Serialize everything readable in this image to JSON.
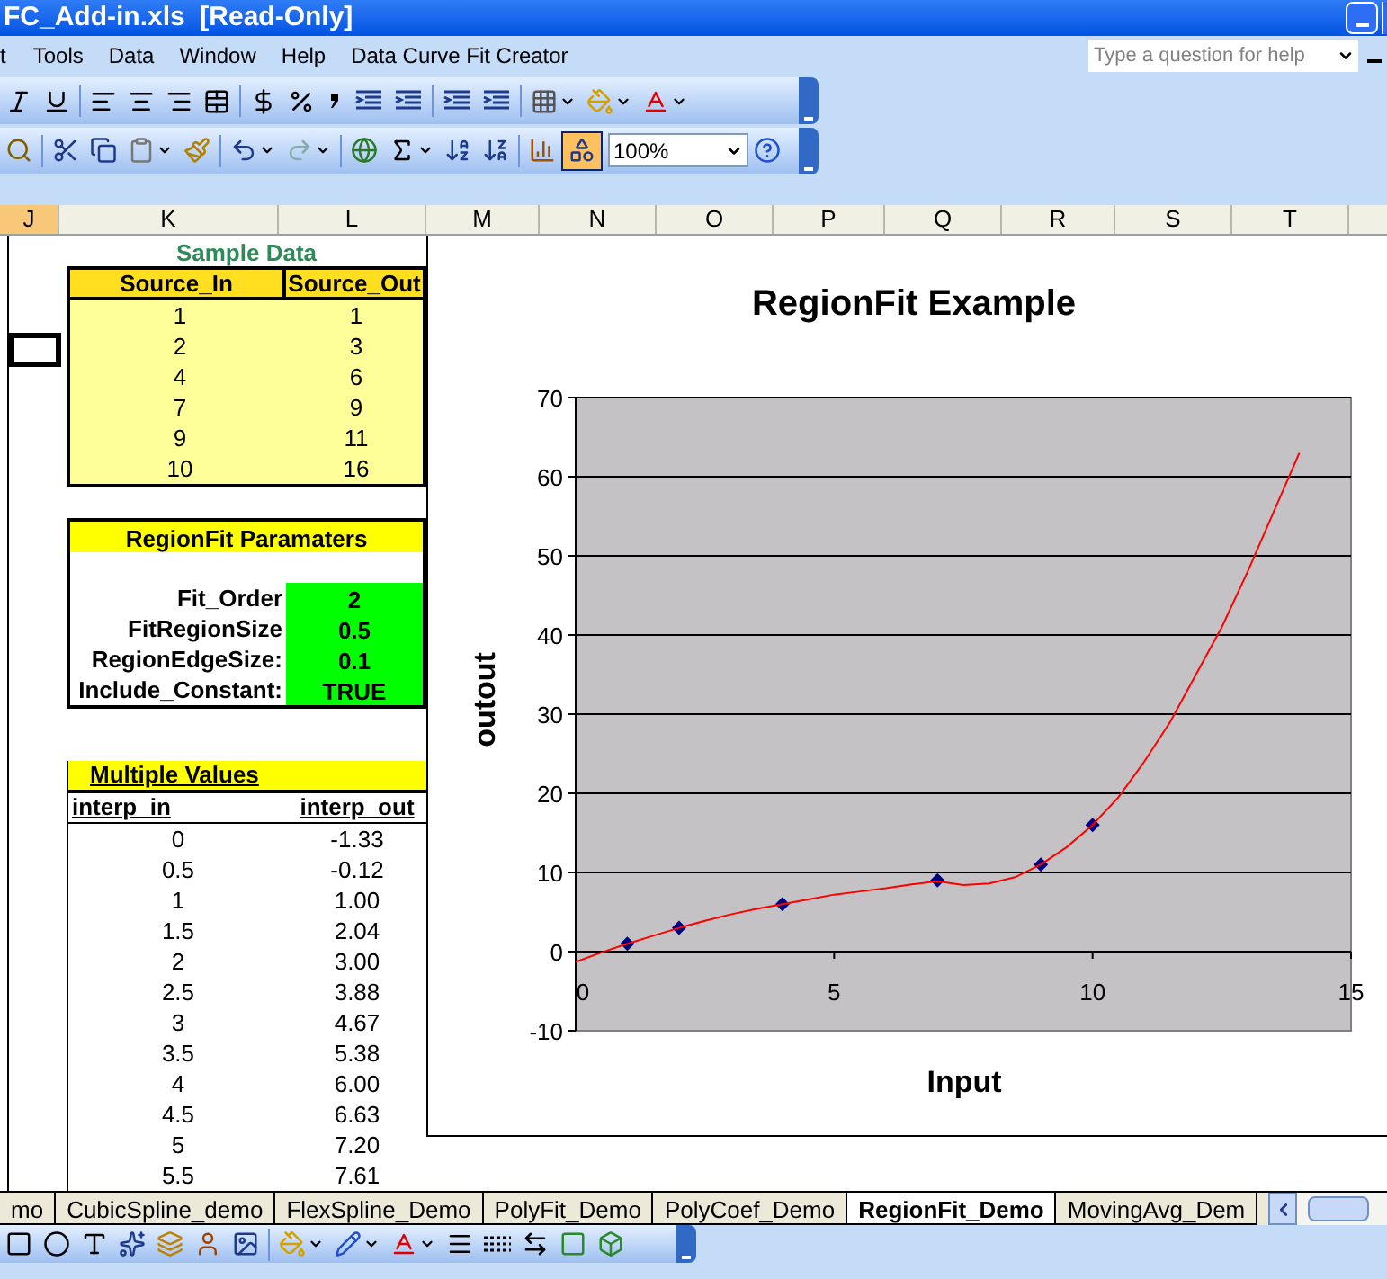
{
  "window": {
    "title": "FC_Add-in.xls  [Read-Only]"
  },
  "menu": [
    {
      "label": "t"
    },
    {
      "label": "Tools"
    },
    {
      "label": "Data"
    },
    {
      "label": "Window"
    },
    {
      "label": "Help"
    },
    {
      "label": "Data Curve Fit Creator"
    }
  ],
  "help_box": {
    "placeholder": "Type a question for help"
  },
  "toolbar": {
    "zoom": "100%",
    "drawing_pressed": true
  },
  "columns": [
    {
      "label": "J",
      "selected": true
    },
    {
      "label": "K",
      "selected": false
    },
    {
      "label": "L",
      "selected": false
    },
    {
      "label": "M",
      "selected": false
    },
    {
      "label": "N",
      "selected": false
    },
    {
      "label": "O",
      "selected": false
    },
    {
      "label": "P",
      "selected": false
    },
    {
      "label": "Q",
      "selected": false
    },
    {
      "label": "R",
      "selected": false
    },
    {
      "label": "S",
      "selected": false
    },
    {
      "label": "T",
      "selected": false
    }
  ],
  "sample_data": {
    "title": "Sample Data",
    "columns": [
      "Source_In",
      "Source_Out"
    ],
    "rows": [
      [
        "1",
        "1"
      ],
      [
        "2",
        "3"
      ],
      [
        "4",
        "6"
      ],
      [
        "7",
        "9"
      ],
      [
        "9",
        "11"
      ],
      [
        "10",
        "16"
      ]
    ]
  },
  "parameters": {
    "title": "RegionFit Paramaters",
    "rows": [
      {
        "label": "Fit_Order",
        "value": "2"
      },
      {
        "label": "FitRegionSize",
        "value": "0.5"
      },
      {
        "label": "RegionEdgeSize:",
        "value": "0.1"
      },
      {
        "label": "Include_Constant:",
        "value": "TRUE"
      }
    ]
  },
  "multiple_values": {
    "title": "Multiple Values",
    "columns": [
      "interp_in",
      "interp_out"
    ],
    "rows": [
      [
        "0",
        "-1.33"
      ],
      [
        "0.5",
        "-0.12"
      ],
      [
        "1",
        "1.00"
      ],
      [
        "1.5",
        "2.04"
      ],
      [
        "2",
        "3.00"
      ],
      [
        "2.5",
        "3.88"
      ],
      [
        "3",
        "4.67"
      ],
      [
        "3.5",
        "5.38"
      ],
      [
        "4",
        "6.00"
      ],
      [
        "4.5",
        "6.63"
      ],
      [
        "5",
        "7.20"
      ],
      [
        "5.5",
        "7.61"
      ]
    ]
  },
  "chart": {
    "chart_data": {
      "type": "scatter",
      "title": "RegionFit Example",
      "xlabel": "Input",
      "ylabel": "outout",
      "grid": true,
      "xlim": [
        0,
        15
      ],
      "ylim": [
        -10,
        70
      ],
      "xticks": [
        0,
        5,
        10,
        15
      ],
      "yticks": [
        -10,
        0,
        10,
        20,
        30,
        40,
        50,
        60,
        70
      ],
      "series": [
        {
          "type": "scatter",
          "color": "#000080",
          "x": [
            1,
            2,
            4,
            7,
            9,
            10
          ],
          "values": [
            1,
            3,
            6,
            9,
            11,
            16
          ]
        },
        {
          "type": "line",
          "color": "#ff0000",
          "x": [
            0,
            0.5,
            1,
            1.5,
            2,
            2.5,
            3,
            3.5,
            4,
            4.5,
            5,
            5.5,
            6,
            6.5,
            7,
            7.5,
            8,
            8.5,
            9,
            9.5,
            10,
            10.5,
            11,
            11.5,
            12,
            12.5,
            13,
            13.5,
            14
          ],
          "values": [
            -1.3,
            -0.1,
            1.0,
            2.0,
            3.0,
            3.9,
            4.7,
            5.4,
            6.0,
            6.6,
            7.2,
            7.6,
            8.0,
            8.5,
            8.9,
            8.4,
            8.6,
            9.4,
            11.0,
            13.2,
            16.0,
            19.5,
            24,
            29,
            35,
            41,
            48,
            55.5,
            63
          ]
        }
      ]
    }
  },
  "sheet_tabs": [
    {
      "label": "mo",
      "selected": false
    },
    {
      "label": "CubicSpline_demo",
      "selected": false
    },
    {
      "label": "FlexSpline_Demo",
      "selected": false
    },
    {
      "label": "PolyFit_Demo",
      "selected": false
    },
    {
      "label": "PolyCoef_Demo",
      "selected": false
    },
    {
      "label": "RegionFit_Demo",
      "selected": true
    },
    {
      "label": "MovingAvg_Dem",
      "selected": false
    }
  ]
}
